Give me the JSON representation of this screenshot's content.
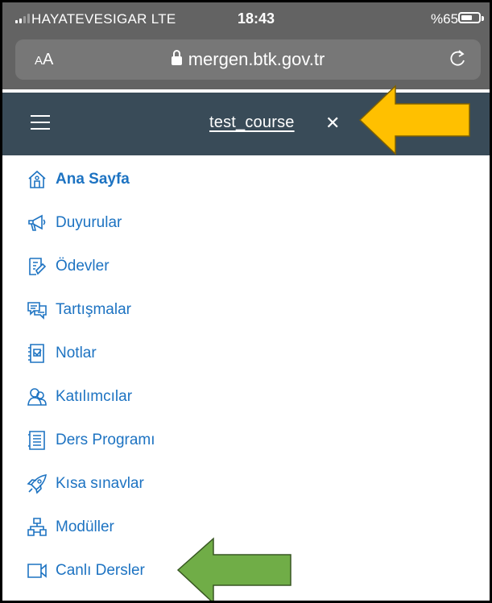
{
  "status_bar": {
    "carrier": "HAYATEVESIGAR  LTE",
    "time": "18:43",
    "battery": "%65",
    "battery_level_percent": 65
  },
  "browser": {
    "text_size_button": "AA",
    "url": "mergen.btk.gov.tr",
    "lock_icon": "lock-icon",
    "reload_icon": "reload-icon"
  },
  "header": {
    "menu_icon": "hamburger-icon",
    "course_title": "test_course",
    "close_label": "✕",
    "background_color": "#394b58"
  },
  "menu": {
    "items": [
      {
        "label": "Ana Sayfa",
        "icon": "home-icon",
        "active": true
      },
      {
        "label": "Duyurular",
        "icon": "megaphone-icon"
      },
      {
        "label": "Ödevler",
        "icon": "assignment-icon"
      },
      {
        "label": "Tartışmalar",
        "icon": "discussion-icon"
      },
      {
        "label": "Notlar",
        "icon": "grades-icon"
      },
      {
        "label": "Katılımcılar",
        "icon": "people-icon"
      },
      {
        "label": "Ders Programı",
        "icon": "syllabus-icon"
      },
      {
        "label": "Kısa sınavlar",
        "icon": "quiz-rocket-icon"
      },
      {
        "label": "Modüller",
        "icon": "modules-icon"
      },
      {
        "label": "Canlı Dersler",
        "icon": "video-icon"
      }
    ],
    "link_color": "#1d73c2"
  },
  "annotations": {
    "top_arrow_color": "#ffc000",
    "bottom_arrow_color": "#70ad47"
  }
}
